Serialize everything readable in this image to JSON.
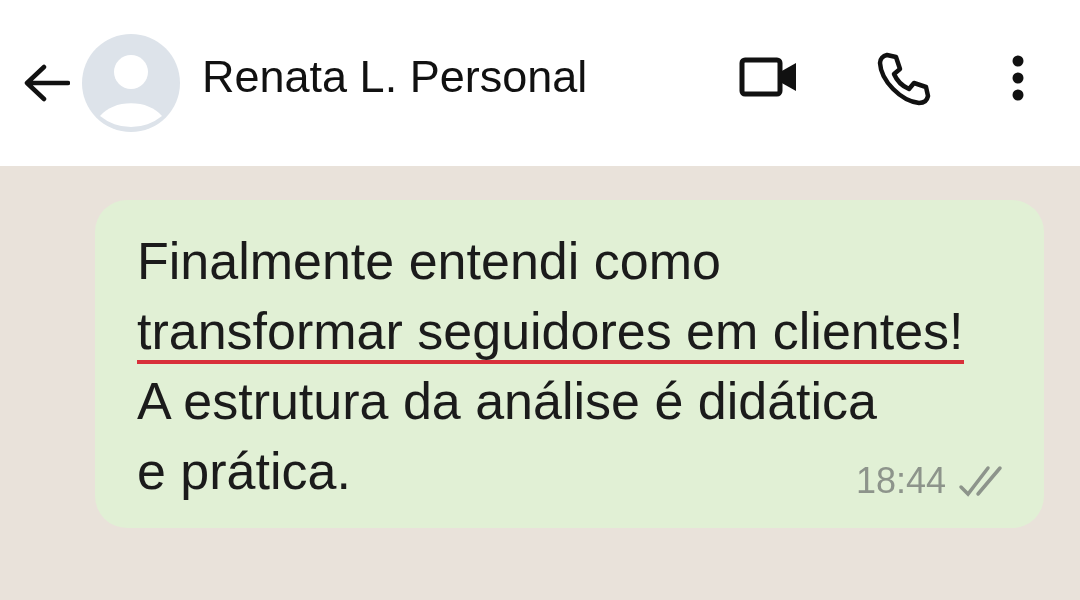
{
  "header": {
    "contact_name": "Renata L. Personal"
  },
  "message": {
    "lines": [
      {
        "text": "Finalmente entendi como",
        "underlined": false
      },
      {
        "text": "transformar seguidores em clientes!",
        "underlined": true
      },
      {
        "text": "A estrutura da análise é didática",
        "underlined": false
      },
      {
        "text": "e prática.",
        "underlined": false
      }
    ],
    "time": "18:44"
  }
}
